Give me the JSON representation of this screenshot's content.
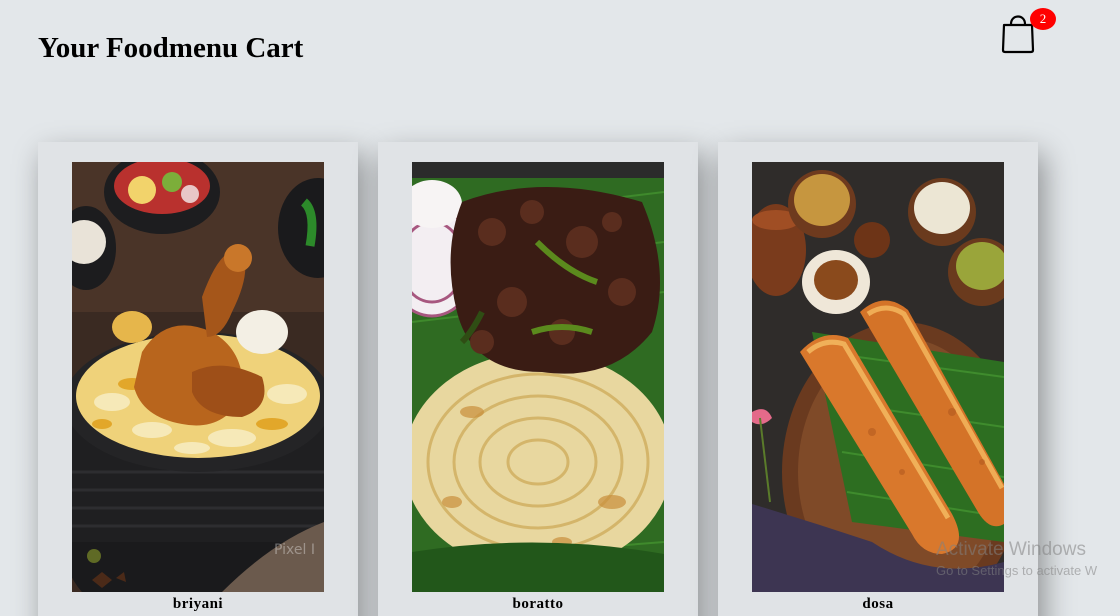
{
  "header": {
    "title": "Your Foodmenu Cart",
    "cart_icon": "shopping-bag-icon",
    "cart_count": "2"
  },
  "products": [
    {
      "name": "briyani",
      "image": "biryani-photo",
      "watermark": "Pixel I"
    },
    {
      "name": "boratto",
      "image": "beef-fry-parotta-photo"
    },
    {
      "name": "dosa",
      "image": "dosa-with-chutneys-photo"
    }
  ],
  "system_overlay": {
    "title": "Activate Windows",
    "subtitle": "Go to Settings to activate W"
  },
  "colors": {
    "background": "#e3e7ea",
    "card": "#e0e3e6",
    "badge": "#ff0000"
  }
}
